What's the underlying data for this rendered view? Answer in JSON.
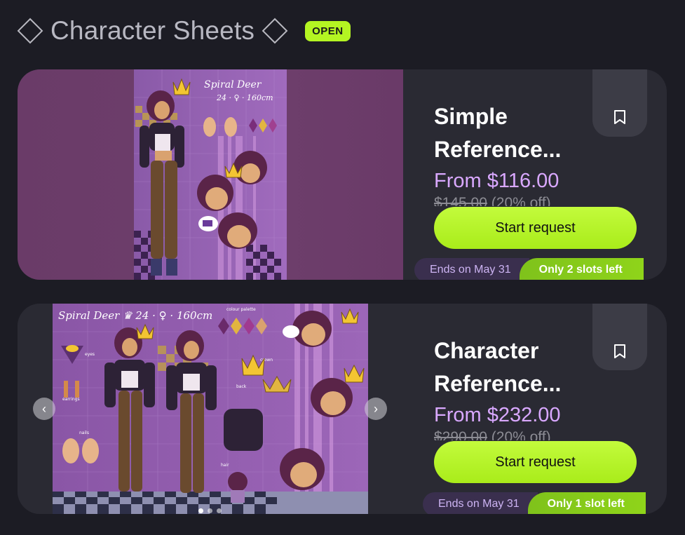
{
  "header": {
    "title": "Character Sheets",
    "status_badge": "OPEN"
  },
  "cards": [
    {
      "title": "Simple Reference...",
      "price": "From $116.00",
      "old_price": "$145.00",
      "discount": "(20% off)",
      "button_label": "Start request",
      "ends_label": "Ends on May 31",
      "slots_label": "Only 2 slots left",
      "art_text": [
        "Spiral Deer",
        "24 · ♀ · 160cm"
      ]
    },
    {
      "title": "Character Reference...",
      "price": "From $232.00",
      "old_price": "$290.00",
      "discount": "(20% off)",
      "button_label": "Start request",
      "ends_label": "Ends on May 31",
      "slots_label": "Only 1 slot left",
      "art_text": [
        "Spiral Deer ♛ 24 · ♀ · 160cm",
        "colour palette",
        "eyes",
        "earrings",
        "nails",
        "crown",
        "back",
        "hair"
      ],
      "carousel": {
        "prev_icon": "chevron-left-icon",
        "next_icon": "chevron-right-icon",
        "dots": 3,
        "active_dot": 0
      }
    }
  ],
  "colors": {
    "background": "#1c1c24",
    "card": "#2a2a33",
    "accent_green": "#b4f522",
    "price_purple": "#d9a8ff"
  }
}
